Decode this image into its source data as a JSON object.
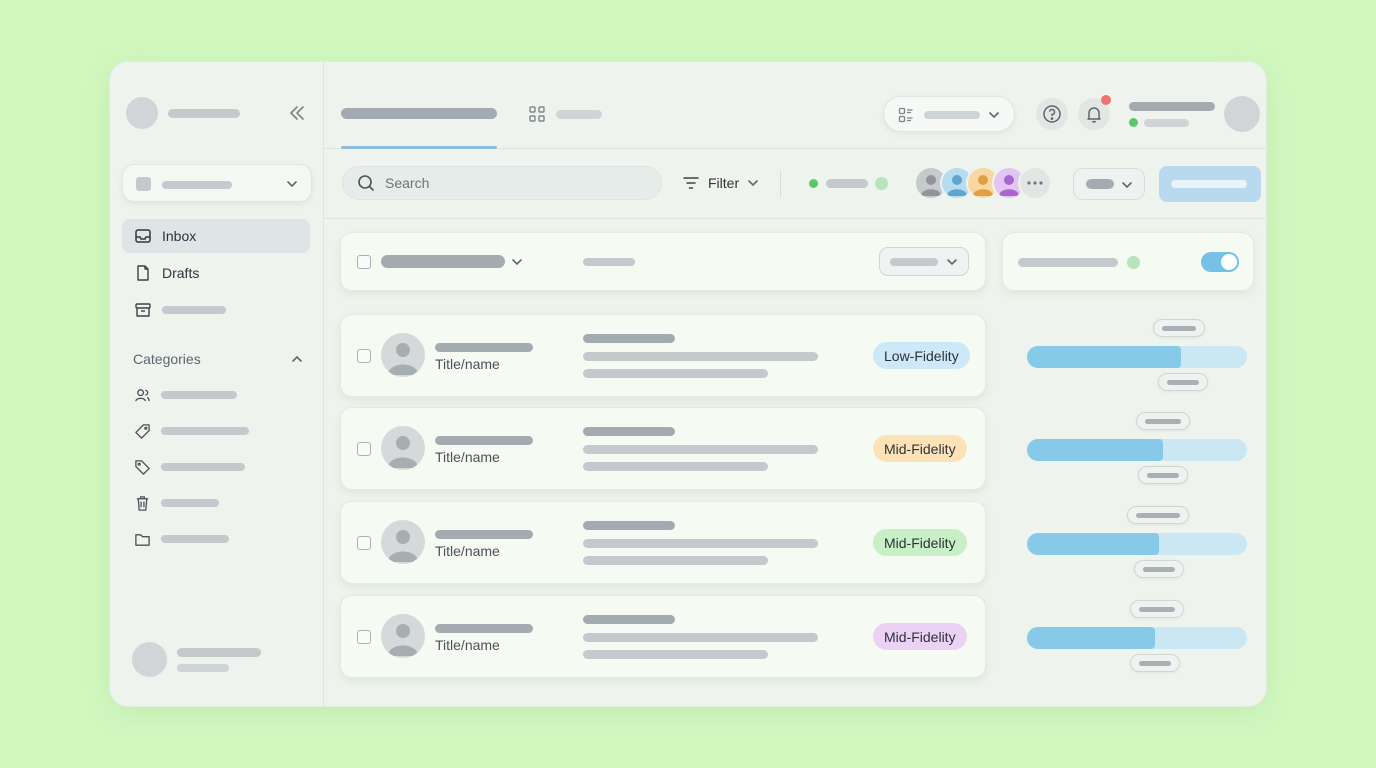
{
  "sidebar": {
    "nav": [
      {
        "label": "Inbox",
        "icon": "inbox-icon",
        "active": true
      },
      {
        "label": "Drafts",
        "icon": "file-icon",
        "active": false
      },
      {
        "label": "",
        "icon": "archive-icon",
        "active": false
      }
    ],
    "categories_label": "Categories",
    "categories": [
      {
        "icon": "users-icon"
      },
      {
        "icon": "tag-icon"
      },
      {
        "icon": "tag-small-icon"
      },
      {
        "icon": "trash-icon"
      },
      {
        "icon": "folder-icon"
      }
    ]
  },
  "toolbar": {
    "search_placeholder": "Search",
    "filter_label": "Filter"
  },
  "rows": [
    {
      "title": "Title/name",
      "badge": "Low-Fidelity",
      "badge_color": "#cde8f6",
      "progress": 0.7
    },
    {
      "title": "Title/name",
      "badge": "Mid-Fidelity",
      "badge_color": "#fde2b8",
      "progress": 0.62
    },
    {
      "title": "Title/name",
      "badge": "Mid-Fidelity",
      "badge_color": "#c9efc6",
      "progress": 0.6
    },
    {
      "title": "Title/name",
      "badge": "Mid-Fidelity",
      "badge_color": "#ebd2f5",
      "progress": 0.58
    }
  ],
  "colors": {
    "background": "#d2f8c0",
    "accent": "#86c9e8",
    "primary_button": "#b8d9ee",
    "online": "#5cc76a",
    "notification": "#f07272"
  }
}
